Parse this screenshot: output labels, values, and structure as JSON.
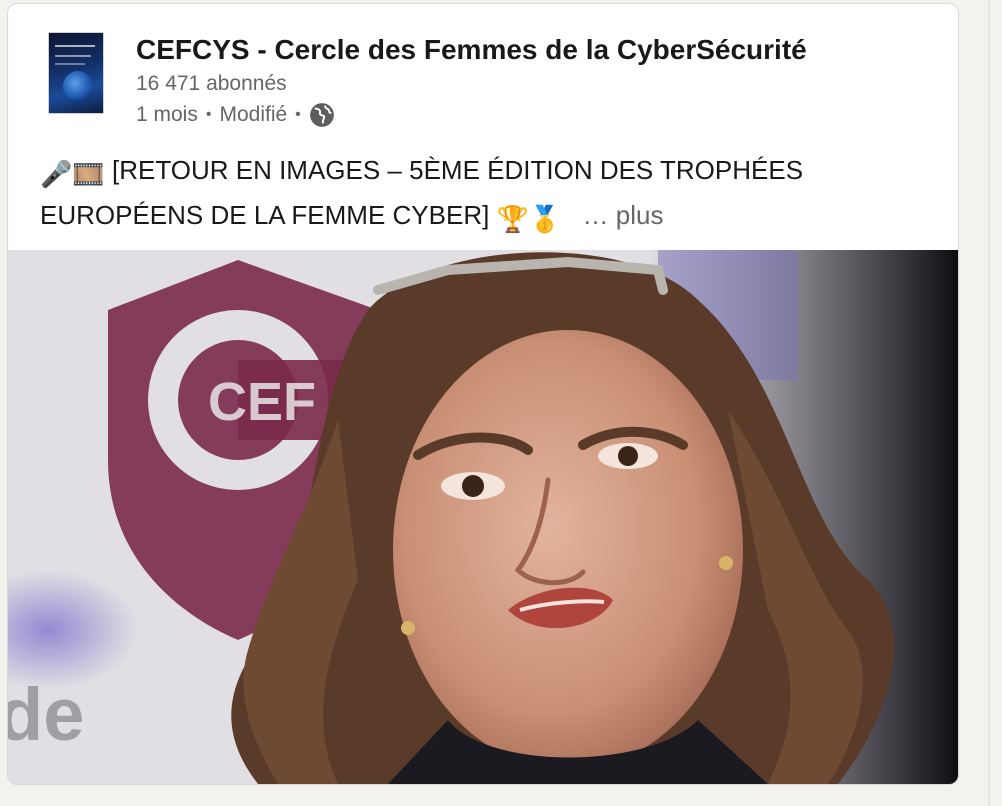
{
  "post": {
    "page_name": "CEFCYS - Cercle des Femmes de la CyberSécurité",
    "followers": "16 471 abonnés",
    "time": "1 mois",
    "separator": "•",
    "edited": "Modifié",
    "visibility_icon": "globe-icon",
    "text_emoji_start": "🎤🎞️",
    "text": "[RETOUR EN IMAGES – 5ÈME ÉDITION DES TROPHÉES EUROPÉENS DE LA FEMME CYBER]",
    "text_emoji_end": "🏆🥇",
    "see_more": "… plus"
  },
  "media": {
    "background_watermark": "de"
  },
  "colors": {
    "text_primary": "#191919",
    "text_secondary": "#666666",
    "page_bg": "#f4f2ee",
    "logo_burgundy": "#7a2a4a"
  }
}
